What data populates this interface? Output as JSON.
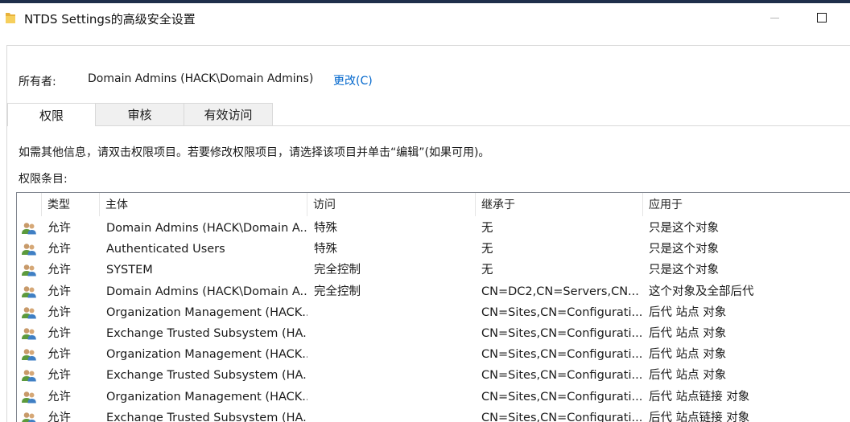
{
  "window": {
    "title": "NTDS Settings的高级安全设置"
  },
  "owner": {
    "label": "所有者:",
    "value": "Domain Admins (HACK\\Domain Admins)",
    "change_link": "更改(C)"
  },
  "tabs": [
    {
      "label": "权限",
      "active": true
    },
    {
      "label": "审核",
      "active": false
    },
    {
      "label": "有效访问",
      "active": false
    }
  ],
  "info_text": "如需其他信息，请双击权限项目。若要修改权限项目，请选择该项目并单击“编辑”(如果可用)。",
  "entries_label": "权限条目:",
  "columns": [
    "类型",
    "主体",
    "访问",
    "继承于",
    "应用于"
  ],
  "rows": [
    {
      "icon": "users-icon",
      "type": "允许",
      "principal": "Domain Admins (HACK\\Domain A...",
      "access": "特殊",
      "inherited": "无",
      "applies": "只是这个对象"
    },
    {
      "icon": "users-icon",
      "type": "允许",
      "principal": "Authenticated Users",
      "access": "特殊",
      "inherited": "无",
      "applies": "只是这个对象"
    },
    {
      "icon": "users-icon",
      "type": "允许",
      "principal": "SYSTEM",
      "access": "完全控制",
      "inherited": "无",
      "applies": "只是这个对象"
    },
    {
      "icon": "users-icon",
      "type": "允许",
      "principal": "Domain Admins (HACK\\Domain A...",
      "access": "完全控制",
      "inherited": "CN=DC2,CN=Servers,CN...",
      "applies": "这个对象及全部后代"
    },
    {
      "icon": "users-icon",
      "type": "允许",
      "principal": "Organization Management (HACK...",
      "access": "",
      "inherited": "CN=Sites,CN=Configurati...",
      "applies": "后代 站点 对象"
    },
    {
      "icon": "users-icon",
      "type": "允许",
      "principal": "Exchange Trusted Subsystem (HA...",
      "access": "",
      "inherited": "CN=Sites,CN=Configurati...",
      "applies": "后代 站点 对象"
    },
    {
      "icon": "users-icon",
      "type": "允许",
      "principal": "Organization Management (HACK...",
      "access": "",
      "inherited": "CN=Sites,CN=Configurati...",
      "applies": "后代 站点 对象"
    },
    {
      "icon": "users-icon",
      "type": "允许",
      "principal": "Exchange Trusted Subsystem (HA...",
      "access": "",
      "inherited": "CN=Sites,CN=Configurati...",
      "applies": "后代 站点 对象"
    },
    {
      "icon": "users-icon",
      "type": "允许",
      "principal": "Organization Management (HACK...",
      "access": "",
      "inherited": "CN=Sites,CN=Configurati...",
      "applies": "后代 站点链接 对象"
    },
    {
      "icon": "users-icon",
      "type": "允许",
      "principal": "Exchange Trusted Subsystem (HA...",
      "access": "",
      "inherited": "CN=Sites,CN=Configurati...",
      "applies": "后代 站点链接 对象"
    }
  ],
  "icons": {
    "window": "folder-icon",
    "minimize": "minimize-icon",
    "maximize": "maximize-icon"
  },
  "colors": {
    "link": "#0066cc",
    "title_accent": "#1f2f4b"
  }
}
